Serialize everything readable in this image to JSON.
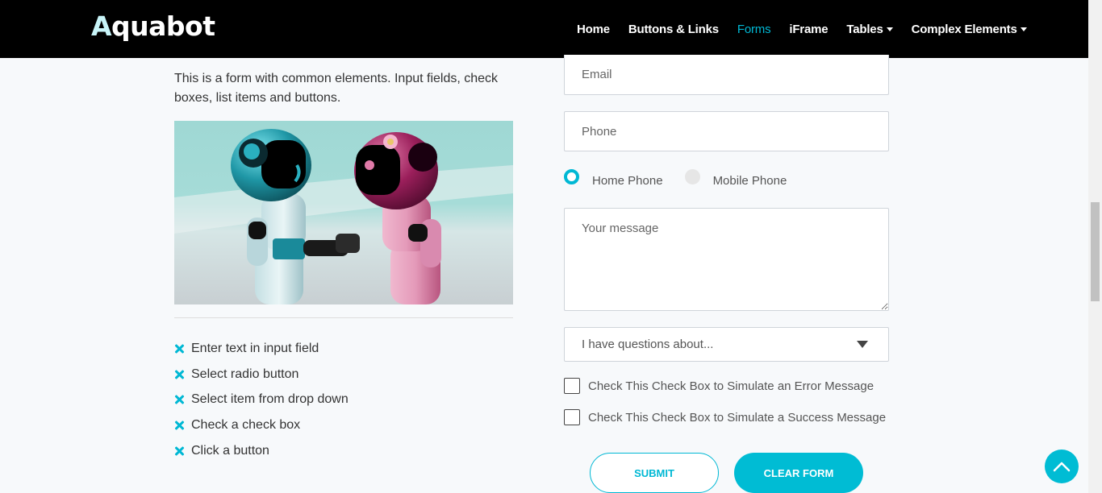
{
  "brand": {
    "name_first": "A",
    "name_rest": "quabot"
  },
  "nav": {
    "items": [
      {
        "label": "Home"
      },
      {
        "label": "Buttons & Links"
      },
      {
        "label": "Forms"
      },
      {
        "label": "iFrame"
      },
      {
        "label": "Tables"
      },
      {
        "label": "Complex Elements"
      }
    ],
    "active": "Forms"
  },
  "intro": "This is a form with common elements. Input fields, check boxes, list items and buttons.",
  "steps": [
    "Enter text in input field",
    "Select radio button",
    "Select item from drop down",
    "Check a check box",
    "Click a button"
  ],
  "form": {
    "email_placeholder": "Email",
    "phone_placeholder": "Phone",
    "radio_home": "Home Phone",
    "radio_mobile": "Mobile Phone",
    "radio_selected": "Home Phone",
    "message_placeholder": "Your message",
    "select_value": "I have questions about...",
    "check_error": "Check This Check Box to Simulate an Error Message",
    "check_success": "Check This Check Box to Simulate a Success Message",
    "submit": "SUBMIT",
    "clear": "CLEAR FORM"
  },
  "colors": {
    "accent": "#00b8d4",
    "navbar": "#000000"
  },
  "icons": {
    "bullet": "x-icon",
    "scroll_top": "chevron-up-icon"
  }
}
